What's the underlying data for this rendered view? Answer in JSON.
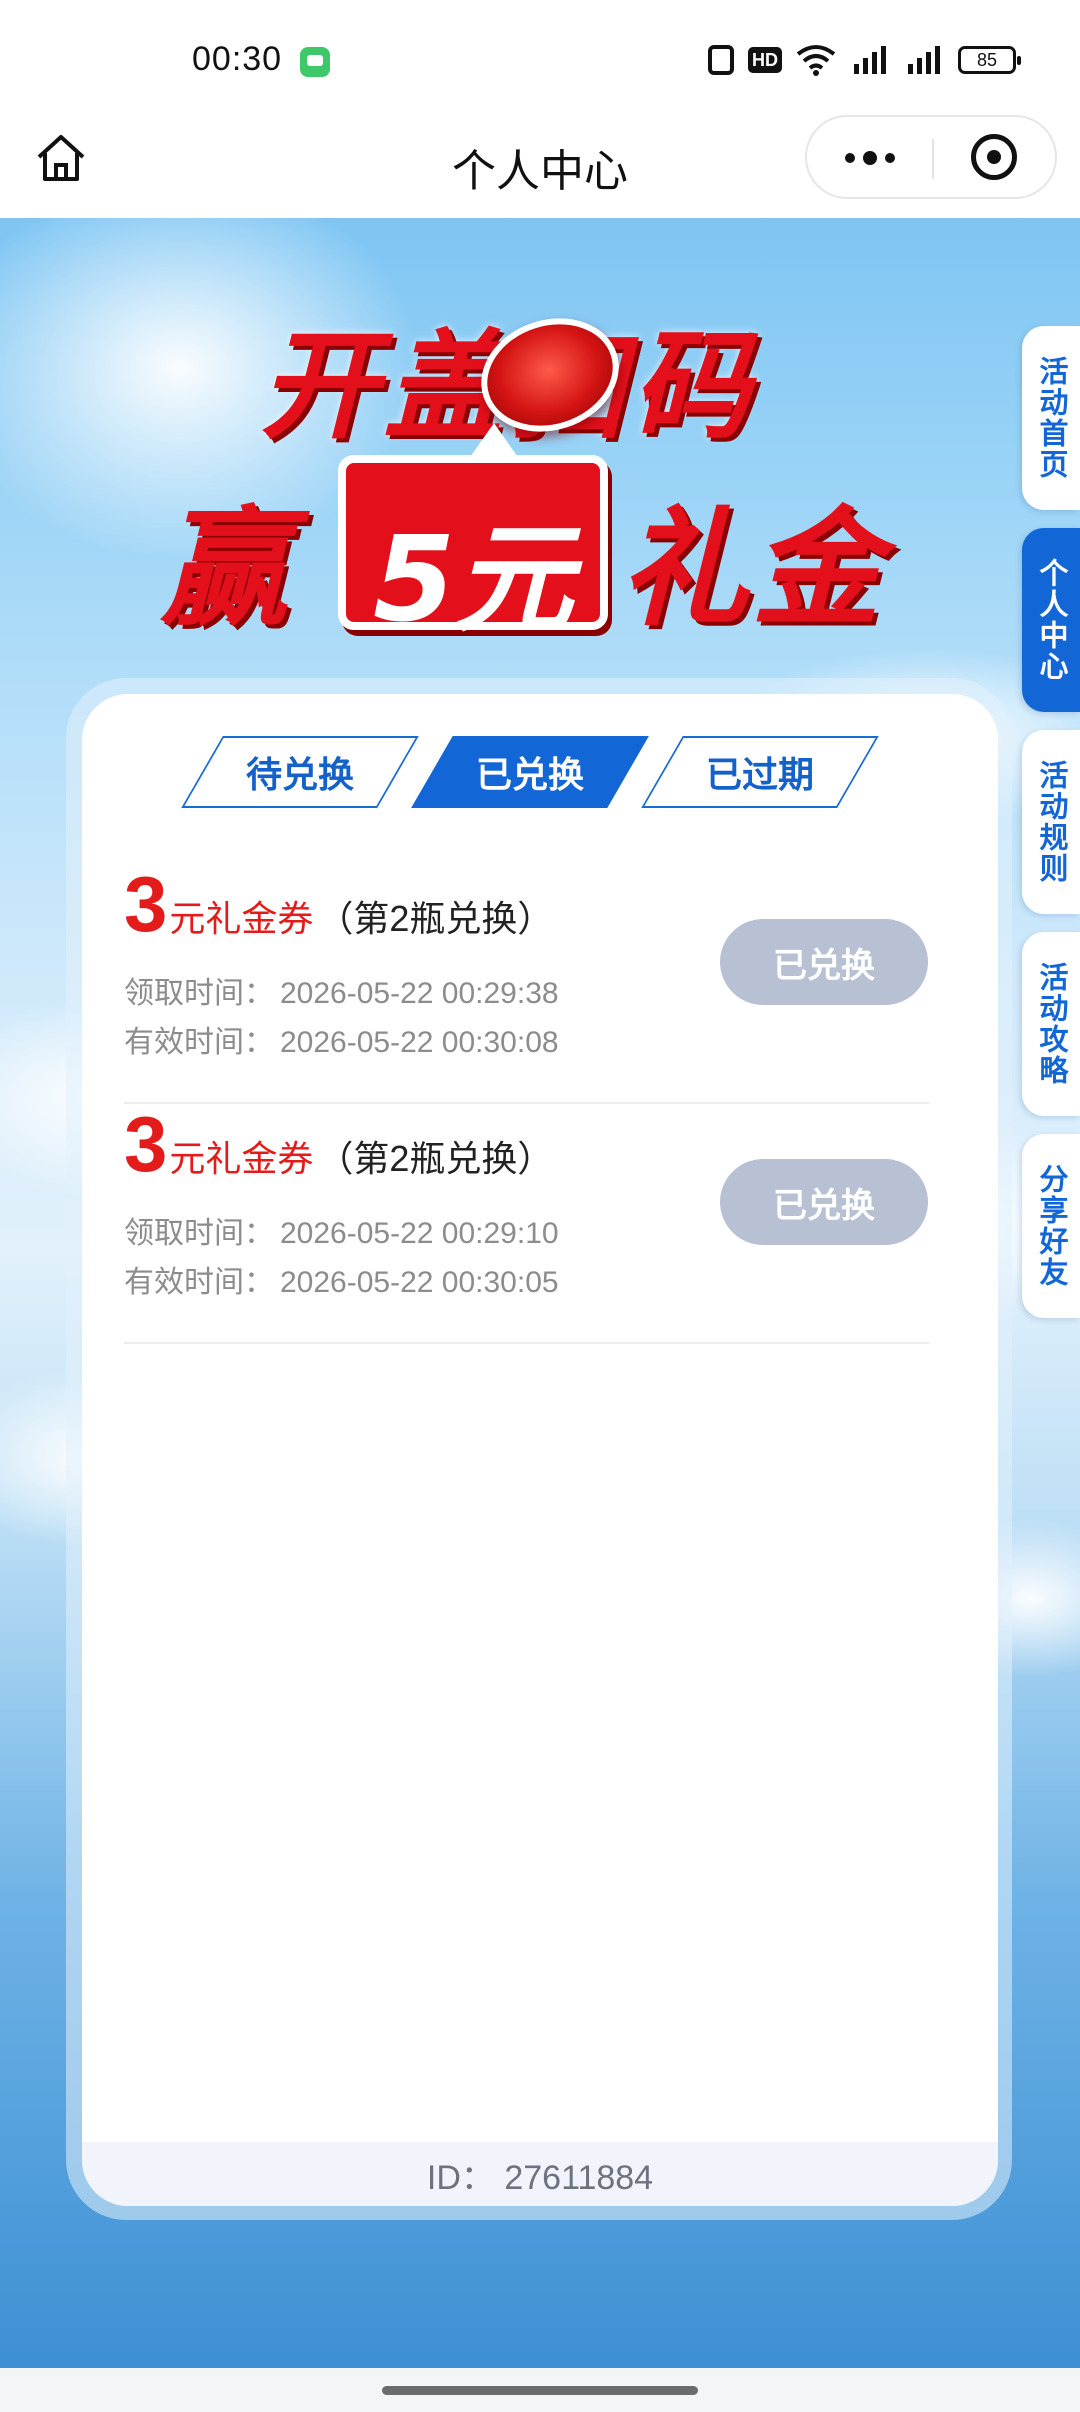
{
  "status_bar": {
    "time": "00:30",
    "hd_label": "HD",
    "battery": "85"
  },
  "nav": {
    "title": "个人中心"
  },
  "banner": {
    "line1": "开盖扫码",
    "win": "赢",
    "amount": "5元",
    "gift": "礼金"
  },
  "tabs": [
    {
      "label": "待兑换",
      "active": false
    },
    {
      "label": "已兑换",
      "active": true
    },
    {
      "label": "已过期",
      "active": false
    }
  ],
  "coupons": [
    {
      "amount": "3",
      "unit": "元礼金券",
      "note": "（第2瓶兑换）",
      "claim_label": "领取时间：",
      "claim_time": "2026-05-22 00:29:38",
      "valid_label": "有效时间：",
      "valid_time": "2026-05-22 00:30:08",
      "button": "已兑换"
    },
    {
      "amount": "3",
      "unit": "元礼金券",
      "note": "（第2瓶兑换）",
      "claim_label": "领取时间：",
      "claim_time": "2026-05-22 00:29:10",
      "valid_label": "有效时间：",
      "valid_time": "2026-05-22 00:30:05",
      "button": "已兑换"
    }
  ],
  "footer": {
    "id_text": "ID：  27611884"
  },
  "side_tabs": [
    {
      "label": "活动首页",
      "active": false
    },
    {
      "label": "个人中心",
      "active": true
    },
    {
      "label": "活动规则",
      "active": false
    },
    {
      "label": "活动攻略",
      "active": false
    },
    {
      "label": "分享好友",
      "active": false
    }
  ],
  "colors": {
    "accent_blue": "#1366d6",
    "coupon_red": "#e31b1b",
    "disabled_button": "#b8c1d3"
  },
  "icons": {
    "home": "home-icon",
    "more": "more-dots-icon",
    "target": "target-icon"
  }
}
